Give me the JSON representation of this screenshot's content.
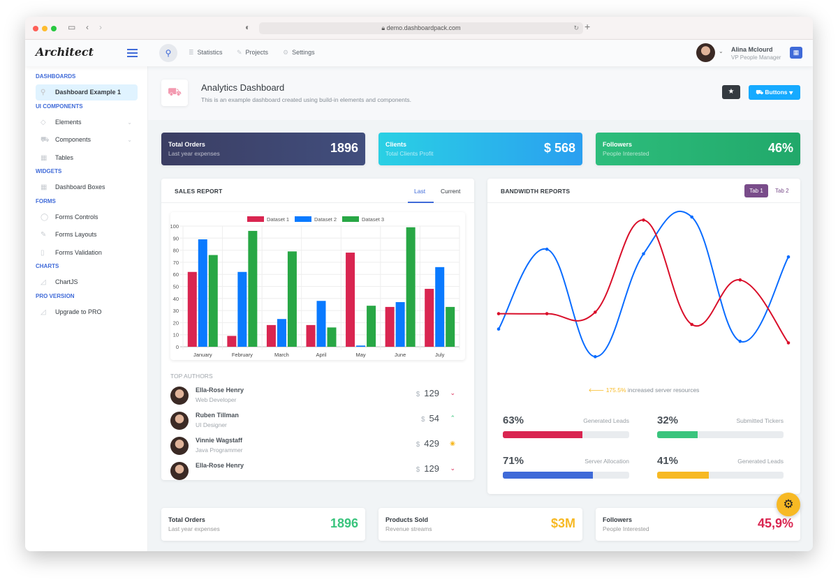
{
  "browser": {
    "url": "demo.dashboardpack.com"
  },
  "app": {
    "logo": "Architect"
  },
  "nav": {
    "statistics": "Statistics",
    "projects": "Projects",
    "settings": "Settings"
  },
  "user": {
    "name": "Alina Mclourd",
    "role": "VP People Manager"
  },
  "sidebar": {
    "sections": [
      {
        "title": "DASHBOARDS",
        "items": [
          {
            "label": "Dashboard Example 1",
            "icon": "rocket-icon",
            "active": true
          }
        ]
      },
      {
        "title": "UI COMPONENTS",
        "items": [
          {
            "label": "Elements",
            "icon": "diamond-icon"
          },
          {
            "label": "Components",
            "icon": "car-icon"
          },
          {
            "label": "Tables",
            "icon": "table-icon"
          }
        ]
      },
      {
        "title": "WIDGETS",
        "items": [
          {
            "label": "Dashboard Boxes",
            "icon": "box-icon"
          }
        ]
      },
      {
        "title": "FORMS",
        "items": [
          {
            "label": "Forms Controls",
            "icon": "mouse-icon"
          },
          {
            "label": "Forms Layouts",
            "icon": "pencil-icon"
          },
          {
            "label": "Forms Validation",
            "icon": "lock-icon"
          }
        ]
      },
      {
        "title": "CHARTS",
        "items": [
          {
            "label": "ChartJS",
            "icon": "graph-icon"
          }
        ]
      },
      {
        "title": "PRO VERSION",
        "items": [
          {
            "label": "Upgrade to PRO",
            "icon": "graph-icon"
          }
        ]
      }
    ]
  },
  "page": {
    "title": "Analytics Dashboard",
    "subtitle": "This is an example dashboard created using build-in elements and components.",
    "buttons_label": "Buttons"
  },
  "stats": [
    {
      "title": "Total Orders",
      "sub": "Last year expenses",
      "value": "1896"
    },
    {
      "title": "Clients",
      "sub": "Total Clients Profit",
      "value": "$ 568"
    },
    {
      "title": "Followers",
      "sub": "People Interested",
      "value": "46%"
    }
  ],
  "sales": {
    "title": "SALES REPORT",
    "tabs": [
      "Last",
      "Current"
    ],
    "active_tab": 0,
    "authors_title": "TOP AUTHORS",
    "authors": [
      {
        "name": "Ella-Rose Henry",
        "role": "Web Developer",
        "currency": "$",
        "amount": "129",
        "trend": "down"
      },
      {
        "name": "Ruben Tillman",
        "role": "UI Designer",
        "currency": "$",
        "amount": "54",
        "trend": "up"
      },
      {
        "name": "Vinnie Wagstaff",
        "role": "Java Programmer",
        "currency": "$",
        "amount": "429",
        "trend": "neutral"
      },
      {
        "name": "Ella-Rose Henry",
        "role": "",
        "currency": "$",
        "amount": "129",
        "trend": "down"
      }
    ]
  },
  "bandwidth": {
    "title": "BANDWIDTH REPORTS",
    "tabs": [
      "Tab 1",
      "Tab 2"
    ],
    "active_tab": 0,
    "note_value": "175.5%",
    "note_text": "increased server resources",
    "progress": [
      {
        "value": "63%",
        "pct": 63,
        "label": "Generated Leads",
        "color": "#d92550"
      },
      {
        "value": "32%",
        "pct": 32,
        "label": "Submitted Tickers",
        "color": "#3ac47d"
      },
      {
        "value": "71%",
        "pct": 71,
        "label": "Server Allocation",
        "color": "#3f6ad8"
      },
      {
        "value": "41%",
        "pct": 41,
        "label": "Generated Leads",
        "color": "#f7b924"
      }
    ]
  },
  "bottom_stats": [
    {
      "title": "Total Orders",
      "sub": "Last year expenses",
      "value": "1896",
      "color": "#3ac47d"
    },
    {
      "title": "Products Sold",
      "sub": "Revenue streams",
      "value": "$3M",
      "color": "#f7b924"
    },
    {
      "title": "Followers",
      "sub": "People Interested",
      "value": "45,9%",
      "color": "#d92550"
    }
  ],
  "chart_data": [
    {
      "type": "bar",
      "categories": [
        "January",
        "February",
        "March",
        "April",
        "May",
        "June",
        "July"
      ],
      "ylim": [
        0,
        100
      ],
      "yticks": [
        "0",
        "10",
        "20",
        "30",
        "40",
        "50",
        "60",
        "70",
        "80",
        "90",
        "100"
      ],
      "grid": true,
      "legend": "top",
      "series": [
        {
          "name": "Dataset 1",
          "color": "#d92550",
          "values": [
            62,
            9,
            18,
            18,
            78,
            33,
            48
          ]
        },
        {
          "name": "Dataset 2",
          "color": "#0a7aff",
          "values": [
            89,
            62,
            23,
            38,
            1,
            37,
            66
          ]
        },
        {
          "name": "Dataset 3",
          "color": "#28a745",
          "values": [
            76,
            96,
            79,
            16,
            34,
            99,
            33
          ]
        }
      ]
    },
    {
      "type": "line",
      "ylim": [
        0,
        100
      ],
      "grid": false,
      "legend": "none",
      "series": [
        {
          "color": "#0a6cff",
          "values": [
            22,
            74,
            4,
            71,
            95,
            14,
            69
          ]
        },
        {
          "color": "#d90f2a",
          "values": [
            32,
            32,
            33,
            93,
            25,
            54,
            13
          ]
        }
      ]
    }
  ]
}
